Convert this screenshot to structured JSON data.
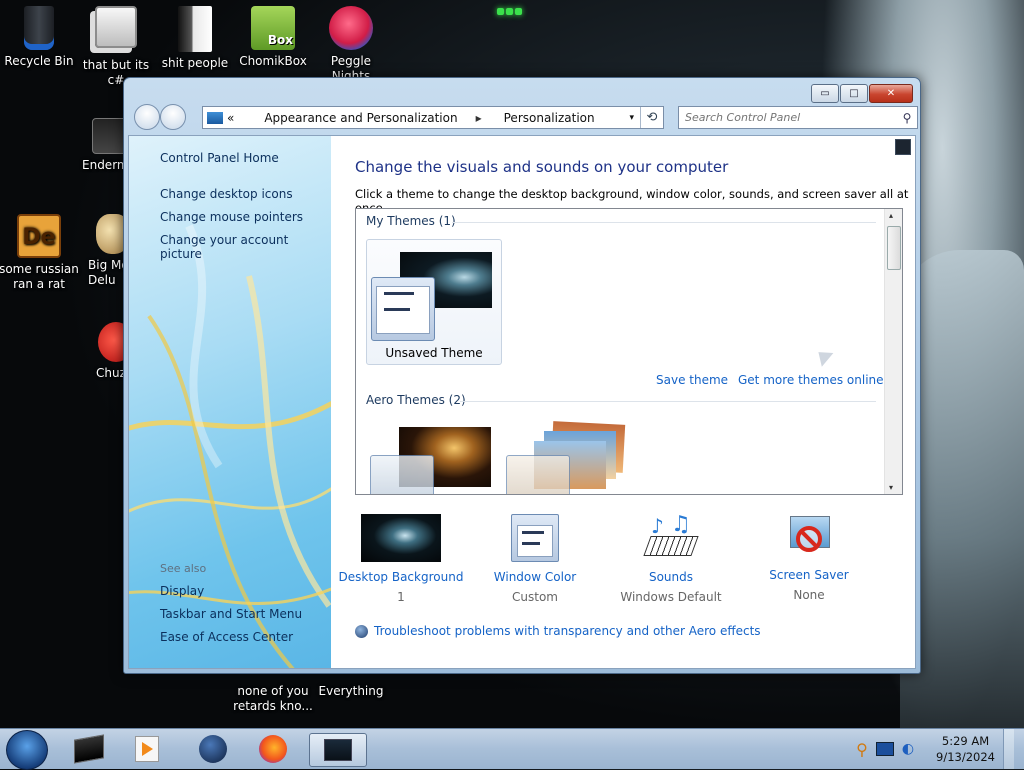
{
  "desktop": {
    "icons": [
      {
        "label": "Recycle Bin"
      },
      {
        "label": "that but its c#"
      },
      {
        "label": "shit people"
      },
      {
        "label": "ChomikBox",
        "sub": "Box"
      },
      {
        "label": "Peggle Nights"
      },
      {
        "label": "Enderm"
      },
      {
        "label": "some russian ran a rat",
        "glyph": "De"
      },
      {
        "label": "Big Mo Delu"
      },
      {
        "label": "Chuz Delu"
      },
      {
        "label": "none of you retards kno..."
      },
      {
        "label": "Everything"
      }
    ]
  },
  "window": {
    "caption_buttons": {
      "minimize": "▭",
      "maximize": "□",
      "close": "✕"
    },
    "address": {
      "prefix": "«",
      "crumbs": [
        "Appearance and Personalization",
        "Personalization"
      ],
      "separator": "▸",
      "dropdown": "▾",
      "refresh": "⟲"
    },
    "search": {
      "placeholder": "Search Control Panel",
      "icon": "search-icon"
    },
    "left_panel": {
      "home": "Control Panel Home",
      "links": [
        "Change desktop icons",
        "Change mouse pointers",
        "Change your account picture"
      ],
      "see_also_label": "See also",
      "see_also": [
        "Display",
        "Taskbar and Start Menu",
        "Ease of Access Center"
      ]
    },
    "main": {
      "title": "Change the visuals and sounds on your computer",
      "subtitle": "Click a theme to change the desktop background, window color, sounds, and screen saver all at once.",
      "my_themes_header": "My Themes (1)",
      "unsaved_theme": "Unsaved Theme",
      "save_theme": "Save theme",
      "get_more": "Get more themes online",
      "aero_header": "Aero Themes (2)",
      "scroll_up": "▴",
      "scroll_down": "▾"
    },
    "bottom": [
      {
        "label": "Desktop Background",
        "value": "1"
      },
      {
        "label": "Window Color",
        "value": "Custom"
      },
      {
        "label": "Sounds",
        "value": "Windows Default"
      },
      {
        "label": "Screen Saver",
        "value": "None"
      }
    ],
    "troubleshoot": "Troubleshoot problems with transparency and other Aero effects"
  },
  "taskbar": {
    "clock_time": "5:29 AM",
    "clock_date": "9/13/2024"
  },
  "colors": {
    "link": "#1563c7",
    "title": "#1e3287"
  }
}
